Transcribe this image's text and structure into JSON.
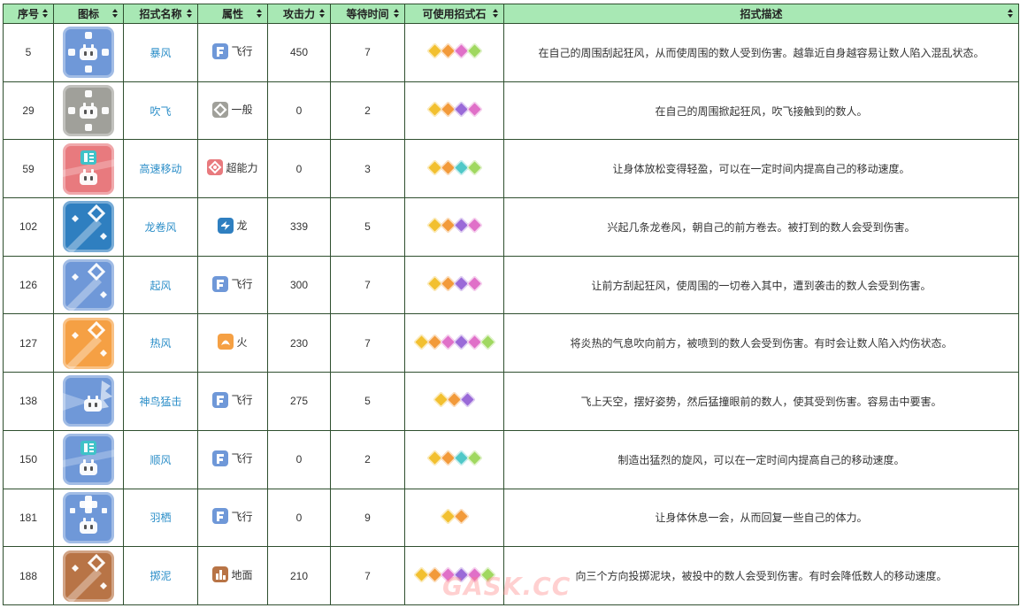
{
  "headers": {
    "index": "序号",
    "icon": "图标",
    "name": "招式名称",
    "attr": "属性",
    "attack": "攻击力",
    "wait": "等待时间",
    "stones": "可使用招式石",
    "desc": "招式描述"
  },
  "colors": {
    "header_bg": "#a8e8b4",
    "link": "#2b8ec8",
    "flying": "#6f98d8",
    "normal": "#a0a09a",
    "psychic": "#e87a7e",
    "dragon": "#2f7fc0",
    "fire": "#f5a044",
    "ground": "#b87446"
  },
  "rows": [
    {
      "index": "5",
      "name": "暴风",
      "attr": "飞行",
      "attr_icon": "flying-type-icon",
      "attack": "450",
      "wait": "7",
      "desc": "在自己的周围刮起狂风，从而使周围的数人受到伤害。越靠近自身越容易让数人陷入混乱状态。",
      "icon_name": "cross-burst-skill-icon",
      "tile_color": "#6f98d8",
      "stones": [
        "#f2c030",
        "#f29a3a",
        "#e070c8",
        "#a0d860"
      ]
    },
    {
      "index": "29",
      "name": "吹飞",
      "attr": "一般",
      "attr_icon": "normal-type-icon",
      "attack": "0",
      "wait": "2",
      "desc": "在自己的周围掀起狂风，吹飞接触到的数人。",
      "icon_name": "cross-burst-skill-icon",
      "tile_color": "#a0a09a",
      "stones": [
        "#f2c030",
        "#f29a3a",
        "#9a6ad8",
        "#e070c8"
      ]
    },
    {
      "index": "59",
      "name": "高速移动",
      "attr": "超能力",
      "attr_icon": "psychic-type-icon",
      "attack": "0",
      "wait": "3",
      "desc": "让身体放松变得轻盈，可以在一定时间内提高自己的移动速度。",
      "icon_name": "speed-buff-skill-icon",
      "tile_color": "#e87a7e",
      "stones": [
        "#f2c030",
        "#f29a3a",
        "#50c8c8",
        "#a0d860"
      ]
    },
    {
      "index": "102",
      "name": "龙卷风",
      "attr": "龙",
      "attr_icon": "dragon-type-icon",
      "attack": "339",
      "wait": "5",
      "desc": "兴起几条龙卷风，朝自己的前方卷去。被打到的数人会受到伤害。",
      "icon_name": "diagonal-strike-skill-icon",
      "tile_color": "#2f7fc0",
      "stones": [
        "#f2c030",
        "#f29a3a",
        "#9a6ad8",
        "#e070c8"
      ]
    },
    {
      "index": "126",
      "name": "起风",
      "attr": "飞行",
      "attr_icon": "flying-type-icon",
      "attack": "300",
      "wait": "7",
      "desc": "让前方刮起狂风，使周围的一切卷入其中，遭到袭击的数人会受到伤害。",
      "icon_name": "diagonal-strike-skill-icon",
      "tile_color": "#6f98d8",
      "stones": [
        "#f2c030",
        "#f29a3a",
        "#9a6ad8",
        "#e070c8"
      ]
    },
    {
      "index": "127",
      "name": "热风",
      "attr": "火",
      "attr_icon": "fire-type-icon",
      "attack": "230",
      "wait": "7",
      "desc": "将炎热的气息吹向前方，被喷到的数人会受到伤害。有时会让数人陷入灼伤状态。",
      "icon_name": "diagonal-strike-skill-icon",
      "tile_color": "#f5a044",
      "stones": [
        "#f2c030",
        "#f29a3a",
        "#e070c8",
        "#9a6ad8",
        "#e070c8",
        "#a0d860"
      ]
    },
    {
      "index": "138",
      "name": "神鸟猛击",
      "attr": "飞行",
      "attr_icon": "flying-type-icon",
      "attack": "275",
      "wait": "5",
      "desc": "飞上天空，摆好姿势，然后猛撞眼前的数人，使其受到伤害。容易击中要害。",
      "icon_name": "charge-skill-icon",
      "tile_color": "#6f98d8",
      "stones": [
        "#f2c030",
        "#f29a3a",
        "#9a6ad8"
      ]
    },
    {
      "index": "150",
      "name": "顺风",
      "attr": "飞行",
      "attr_icon": "flying-type-icon",
      "attack": "0",
      "wait": "2",
      "desc": "制造出猛烈的旋风，可以在一定时间内提高自己的移动速度。",
      "icon_name": "speed-buff-skill-icon",
      "tile_color": "#6f98d8",
      "stones": [
        "#f2c030",
        "#f29a3a",
        "#50c8c8",
        "#a0d860"
      ]
    },
    {
      "index": "181",
      "name": "羽栖",
      "attr": "飞行",
      "attr_icon": "flying-type-icon",
      "attack": "0",
      "wait": "9",
      "desc": "让身体休息一会，从而回复一些自己的体力。",
      "icon_name": "heal-skill-icon",
      "tile_color": "#6f98d8",
      "stones": [
        "#f2c030",
        "#f29a3a"
      ]
    },
    {
      "index": "188",
      "name": "掷泥",
      "attr": "地面",
      "attr_icon": "ground-type-icon",
      "attack": "210",
      "wait": "7",
      "desc": "向三个方向投掷泥块，被投中的数人会受到伤害。有时会降低数人的移动速度。",
      "icon_name": "diagonal-strike-skill-icon",
      "tile_color": "#b87446",
      "stones": [
        "#f2c030",
        "#f29a3a",
        "#e070c8",
        "#9a6ad8",
        "#e070c8",
        "#a0d860"
      ]
    }
  ],
  "watermark": "GASK.CC"
}
